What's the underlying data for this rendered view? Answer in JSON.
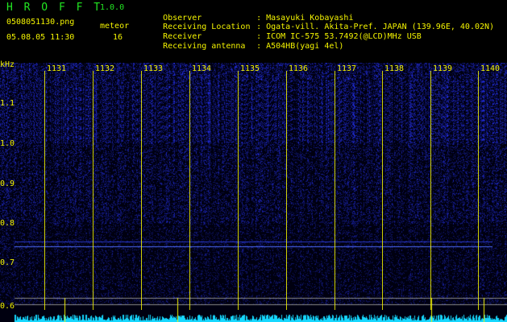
{
  "app": {
    "name": "H R O F F T",
    "version": "1.0.0"
  },
  "file": {
    "name": "0508051130.png",
    "datetime": "05.08.05 11:30"
  },
  "meteor": {
    "label": "meteor",
    "count": "16"
  },
  "header": {
    "observer_label": "Observer",
    "observer_value": "Masayuki Kobayashi",
    "location_label": "Receiving Location",
    "location_value": "Ogata-vill. Akita-Pref. JAPAN (139.96E, 40.02N)",
    "receiver_label": "Receiver",
    "receiver_value": "ICOM IC-575 53.7492(@LCD)MHz USB",
    "antenna_label": "Receiving antenna",
    "antenna_value": "A504HB(yagi 4el)",
    "colon": ":"
  },
  "colors": {
    "label": "#f4f400",
    "title": "#22e622",
    "signal": "#2b39ff",
    "trace": "#16d8ff"
  },
  "axes": {
    "y_unit": "kHz",
    "y_ticks": [
      "1.1",
      "1.0",
      "0.9",
      "0.8",
      "0.7",
      "0.6"
    ],
    "x_ticks": [
      "1131",
      "1132",
      "1133",
      "1134",
      "1135",
      "1136",
      "1137",
      "1138",
      "1139",
      "1140"
    ]
  }
}
